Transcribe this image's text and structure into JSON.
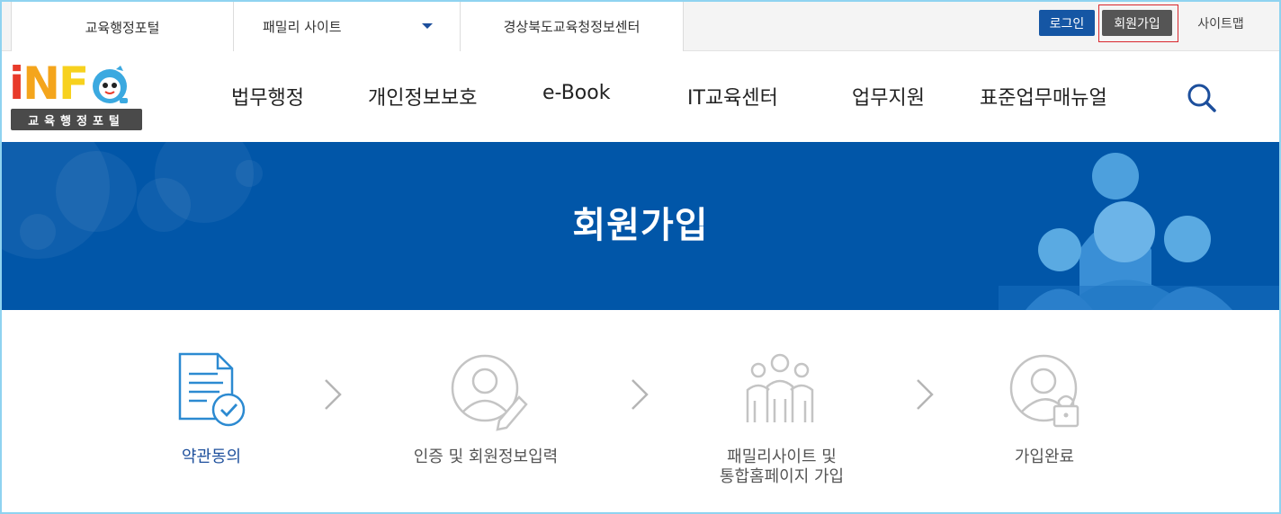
{
  "topbar": {
    "tabs": [
      "교육행정포털",
      "패밀리 사이트",
      "경상북도교육청정보센터"
    ],
    "login": "로그인",
    "join": "회원가입",
    "sitemap": "사이트맵"
  },
  "logo": {
    "letters": [
      "i",
      "N",
      "F",
      "O"
    ],
    "tagline": "교육행정포털"
  },
  "gnb": [
    "법무행정",
    "개인정보보호",
    "e-Book",
    "IT교육센터",
    "업무지원",
    "표준업무매뉴얼"
  ],
  "banner": {
    "title": "회원가입"
  },
  "steps": [
    {
      "label": "약관동의",
      "icon": "document-check-icon",
      "active": true
    },
    {
      "label": "인증 및 회원정보입력",
      "icon": "user-edit-icon",
      "active": false
    },
    {
      "label": "패밀리사이트 및",
      "label2": "통합홈페이지 가입",
      "icon": "family-icon",
      "active": false
    },
    {
      "label": "가입완료",
      "icon": "user-lock-icon",
      "active": false
    }
  ],
  "colors": {
    "brand_blue": "#0156a8",
    "login_blue": "#1556a4",
    "active_step": "#1d4f9c",
    "highlight_red": "#d9272e"
  }
}
